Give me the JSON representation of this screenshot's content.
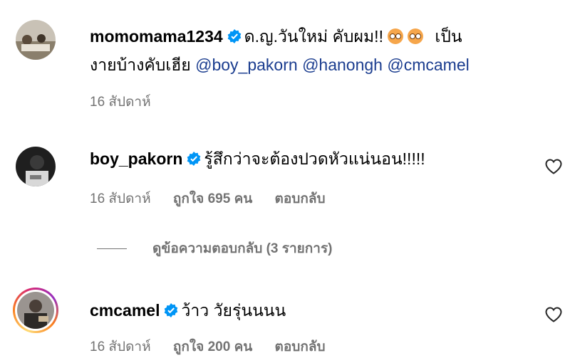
{
  "comments": [
    {
      "username": "momomama1234",
      "text_part1": "ด.ญ.วันใหม่ คับผม!!",
      "text_part2": "เป็น",
      "text_line2": "งายบ้างคับเฮีย",
      "mentions": [
        "@boy_pakorn",
        "@hanongh",
        "@cmcamel"
      ],
      "time": "16 สัปดาห์"
    },
    {
      "username": "boy_pakorn",
      "text": "รู้สึกว่าจะต้องปวดหัวแน่นอน!!!!!",
      "time": "16 สัปดาห์",
      "likes": "ถูกใจ 695 คน",
      "reply": "ตอบกลับ"
    },
    {
      "username": "cmcamel",
      "text": "ว้าว วัยรุ่นนนน",
      "time": "16 สัปดาห์",
      "likes": "ถูกใจ 200 คน",
      "reply": "ตอบกลับ"
    }
  ],
  "view_replies": "ดูข้อความตอบกลับ (3 รายการ)",
  "colors": {
    "verified": "#0095f6",
    "mention": "#1b3d8f",
    "meta": "#737373"
  },
  "icons": [
    "verified-badge-icon",
    "heart-icon",
    "laughing-emoji-icon"
  ]
}
